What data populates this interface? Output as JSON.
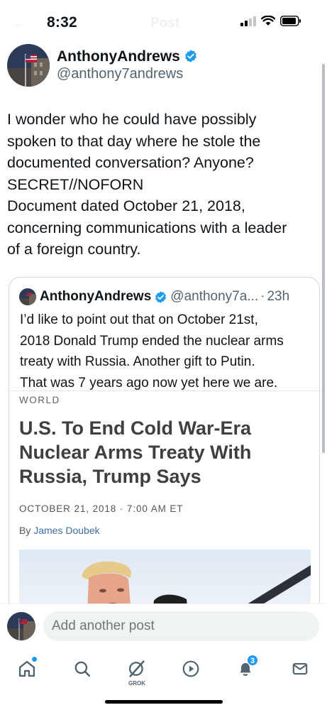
{
  "status_bar": {
    "time": "8:32",
    "ghost_title": "Post",
    "ghost_back": "←"
  },
  "author": {
    "name": "AnthonyAndrews",
    "handle": "@anthony7andrews",
    "verified": true,
    "verified_color": "#1d9bf0"
  },
  "tweet": {
    "lines": [
      "I wonder who he could have possibly",
      "spoken to that day where he stole the",
      "documented conversation? Anyone?",
      "SECRET//NOFORN",
      "Document dated October 21, 2018,",
      "concerning communications with a leader",
      "of a foreign country."
    ]
  },
  "quote": {
    "name": "AnthonyAndrews",
    "handle": "@anthony7a...",
    "separator": "·",
    "time": "23h",
    "lines": [
      "I’d like to point out that on October 21st,",
      "2018 Donald Trump ended the nuclear arms",
      "treaty with Russia. Another gift to Putin.",
      "That was 7 years ago now yet here we are."
    ],
    "article": {
      "section": "WORLD",
      "headline_lines": [
        "U.S. To End Cold War-Era",
        "Nuclear Arms Treaty With",
        "Russia, Trump Says"
      ],
      "date": "OCTOBER 21, 2018 · 7:00 AM ET",
      "byline_prefix": "By",
      "byline_author": "James Doubek"
    }
  },
  "reply": {
    "placeholder": "Add another post"
  },
  "tab_bar": {
    "grok_label": "GROK",
    "notifications_count": "3",
    "accent": "#1d9bf0",
    "icons": [
      "home-icon",
      "search-icon",
      "grok-icon",
      "video-play-icon",
      "notifications-bell-icon",
      "messages-envelope-icon"
    ]
  }
}
